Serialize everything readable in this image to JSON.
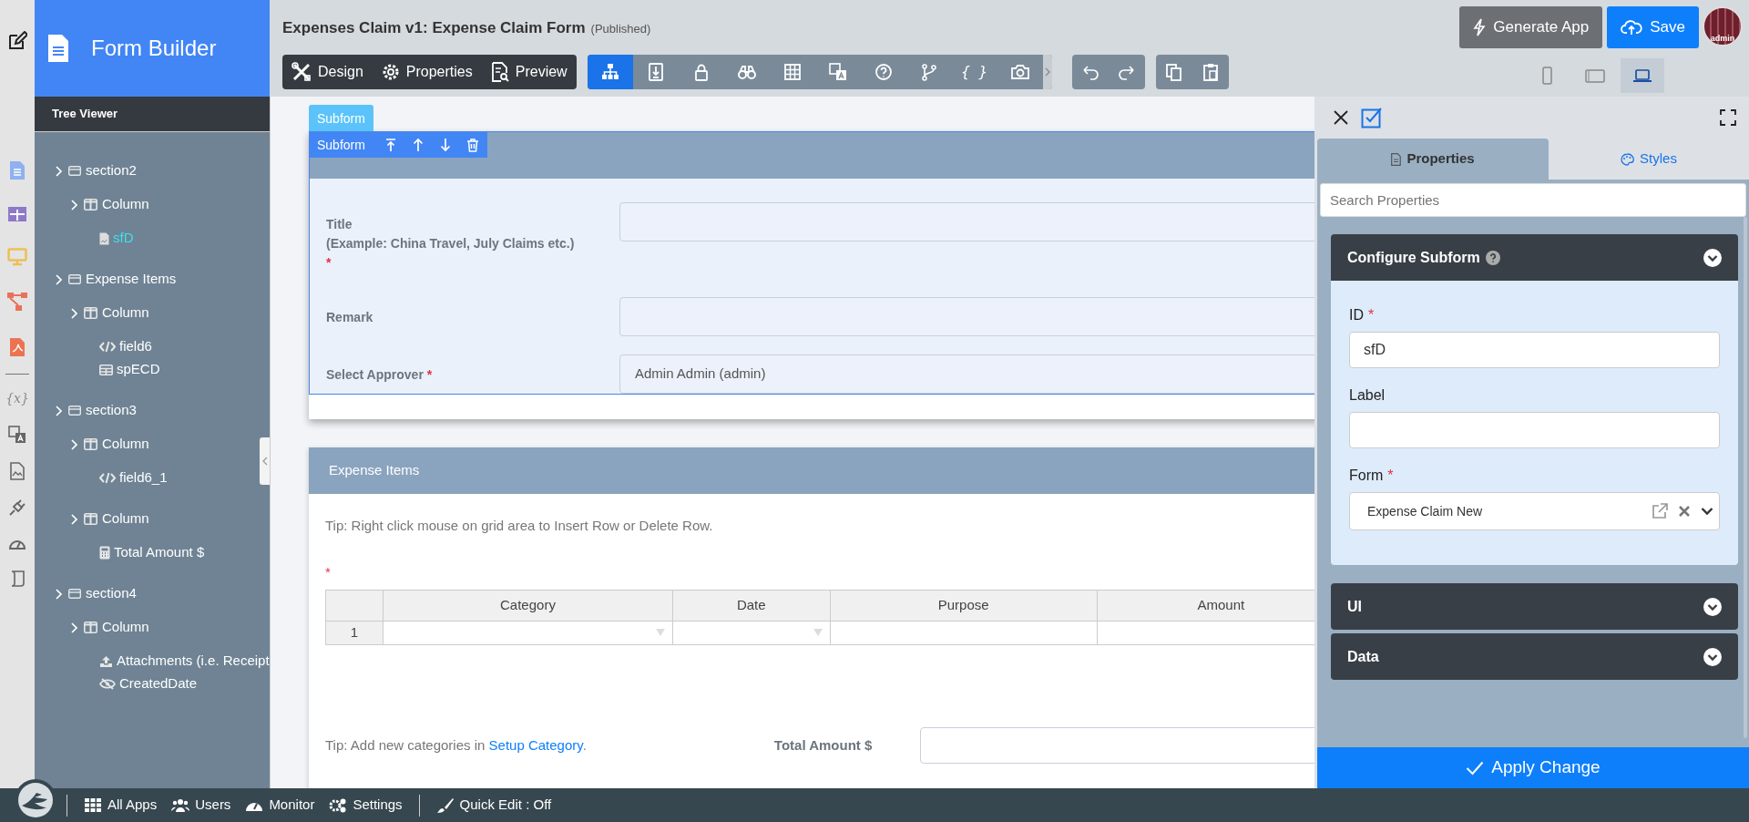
{
  "rail": {
    "variables_glyph": "{x}"
  },
  "brand": {
    "title": "Form Builder"
  },
  "tree": {
    "title": "Tree Viewer",
    "nodes": [
      {
        "label": "section2",
        "kind": "section",
        "selected": false,
        "children": [
          {
            "label": "Column",
            "kind": "column",
            "selected": false,
            "children": [
              {
                "label": "sfD",
                "kind": "subform",
                "selected": true
              }
            ]
          }
        ]
      },
      {
        "label": "Expense Items",
        "kind": "section",
        "selected": false,
        "children": [
          {
            "label": "Column",
            "kind": "column",
            "selected": false,
            "children": [
              {
                "label": "field6",
                "kind": "custom",
                "selected": false
              },
              {
                "label": "spECD",
                "kind": "grid",
                "selected": false
              }
            ]
          }
        ]
      },
      {
        "label": "section3",
        "kind": "section",
        "selected": false,
        "children": [
          {
            "label": "Column",
            "kind": "column",
            "selected": false,
            "children": [
              {
                "label": "field6_1",
                "kind": "custom",
                "selected": false
              }
            ]
          },
          {
            "label": "Column",
            "kind": "column",
            "selected": false,
            "children": [
              {
                "label": "Total Amount $",
                "kind": "calc",
                "selected": false
              }
            ]
          }
        ]
      },
      {
        "label": "section4",
        "kind": "section",
        "selected": false,
        "children": [
          {
            "label": "Column",
            "kind": "column",
            "selected": false,
            "children": [
              {
                "label": "Attachments (i.e. Receipt",
                "kind": "upload",
                "selected": false
              },
              {
                "label": "CreatedDate",
                "kind": "hidden",
                "selected": false
              }
            ]
          }
        ]
      }
    ]
  },
  "header": {
    "title": "Expenses Claim v1: Expense Claim Form",
    "status": "(Published)"
  },
  "mode_buttons": [
    {
      "label": "Design"
    },
    {
      "label": "Properties"
    },
    {
      "label": "Preview"
    }
  ],
  "component_tools": [
    {
      "selected": true
    },
    {
      "selected": false
    },
    {
      "selected": false
    },
    {
      "selected": false
    },
    {
      "selected": false
    },
    {
      "selected": false
    },
    {
      "selected": false
    },
    {
      "selected": false
    },
    {
      "selected": false,
      "glyph": "{ }"
    },
    {
      "selected": false
    }
  ],
  "actions": [
    {
      "label": "Generate App",
      "kind": "generate"
    },
    {
      "label": "Save",
      "kind": "save"
    }
  ],
  "avatar": {
    "label": "admin"
  },
  "devices": [
    {
      "selected": false
    },
    {
      "selected": false
    },
    {
      "selected": true
    }
  ],
  "canvas": {
    "subform_tab": "Subform",
    "element_toolbar": {
      "label": "Subform"
    },
    "details": {
      "fields": [
        {
          "label": "Title",
          "hint": "(Example: China Travel, July Claims etc.)",
          "required_mark": "*"
        },
        {
          "label": "Remark"
        },
        {
          "label": "Select Approver",
          "required_mark": "*",
          "value": "Admin Admin (admin)"
        }
      ]
    },
    "expense_items": {
      "title": "Expense Items",
      "tip": "Tip: Right click mouse on grid area to Insert Row or Delete Row.",
      "required_mark": "*",
      "grid": {
        "columns": [
          {
            "label": "Category",
            "kind": "select"
          },
          {
            "label": "Date",
            "kind": "select"
          },
          {
            "label": "Purpose",
            "kind": "text"
          },
          {
            "label": "Amount",
            "kind": "text"
          }
        ],
        "rows": [
          {
            "number": "1"
          }
        ]
      },
      "footer_tip": {
        "before": "Tip: Add new categories in ",
        "link": "Setup Category",
        "after": "."
      },
      "total": {
        "label": "Total Amount $"
      }
    }
  },
  "properties": {
    "tabs": [
      {
        "label": "Properties",
        "selected": true
      },
      {
        "label": "Styles",
        "selected": false
      }
    ],
    "search": {
      "placeholder": "Search Properties"
    },
    "groups": [
      {
        "title": "Configure Subform",
        "help": true,
        "expanded": true,
        "fields": [
          {
            "label": "ID",
            "required_mark": "*",
            "value": "sfD",
            "kind": "text"
          },
          {
            "label": "Label",
            "kind": "text"
          },
          {
            "label": "Form",
            "required_mark": "*",
            "value": "Expense Claim New",
            "kind": "select"
          }
        ]
      },
      {
        "title": "UI",
        "expanded": false
      },
      {
        "title": "Data",
        "expanded": false
      }
    ],
    "apply": "Apply Change"
  },
  "footer": {
    "items": [
      {
        "label": "All Apps"
      },
      {
        "label": "Users"
      },
      {
        "label": "Monitor"
      },
      {
        "label": "Settings"
      },
      {
        "label": "Quick Edit : Off"
      }
    ]
  }
}
